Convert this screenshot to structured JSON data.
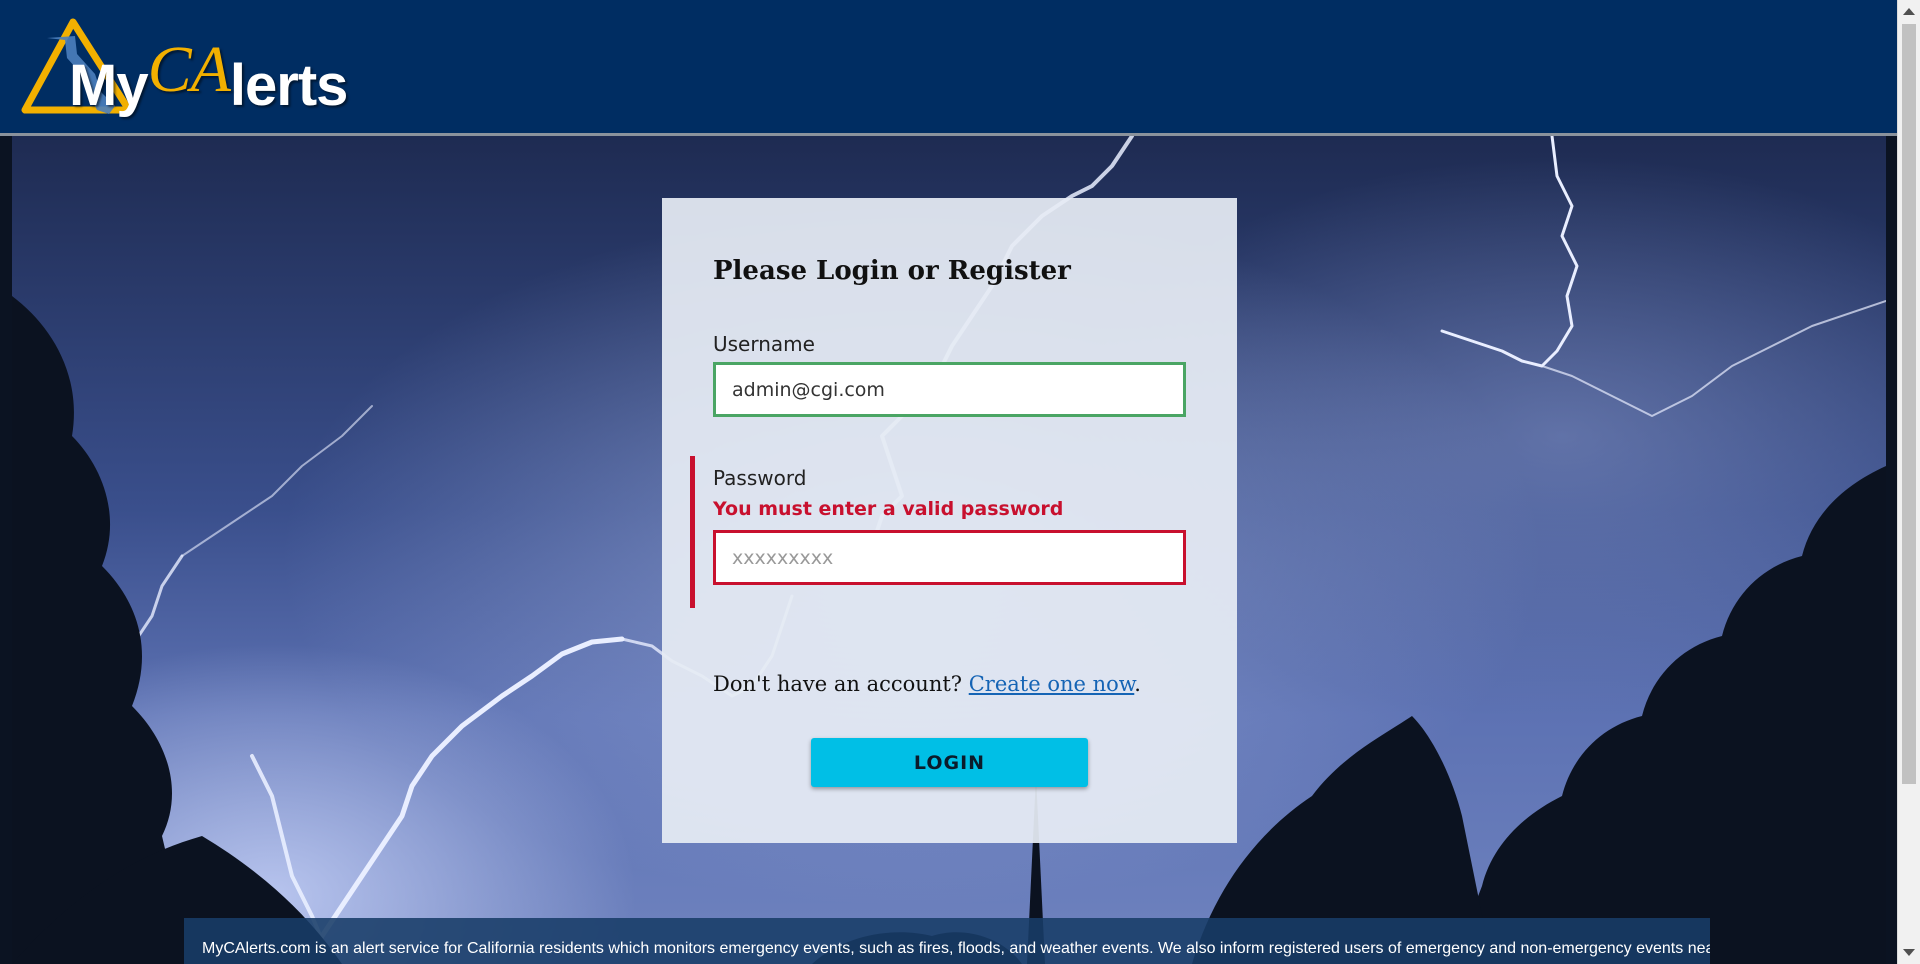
{
  "brand": {
    "logo_text_prefix": "My",
    "logo_text_ca": "CA",
    "logo_text_suffix": "lerts",
    "colors": {
      "header_bg": "#002d62",
      "logo_accent": "#f2b000",
      "primary_button": "#00bfe6",
      "error": "#c8102e",
      "valid": "#4aa564",
      "link": "#1564b5"
    }
  },
  "login": {
    "title": "Please Login or Register",
    "username_label": "Username",
    "username_value": "admin@cgi.com",
    "password_label": "Password",
    "password_error": "You must enter a valid password",
    "password_placeholder": "xxxxxxxxx",
    "no_account_text": "Don't have an account? ",
    "create_link": "Create one now",
    "period": ".",
    "login_button": "LOGIN"
  },
  "footer": {
    "text": "MyCAlerts.com is an alert service for California residents which monitors emergency events, such as fires, floods, and weather events. We also inform registered users of emergency and non-emergency events near"
  },
  "icons": {
    "logo": "california-triangle-logo-icon",
    "scroll_up": "scroll-up-arrow-icon",
    "scroll_down": "scroll-down-arrow-icon"
  }
}
